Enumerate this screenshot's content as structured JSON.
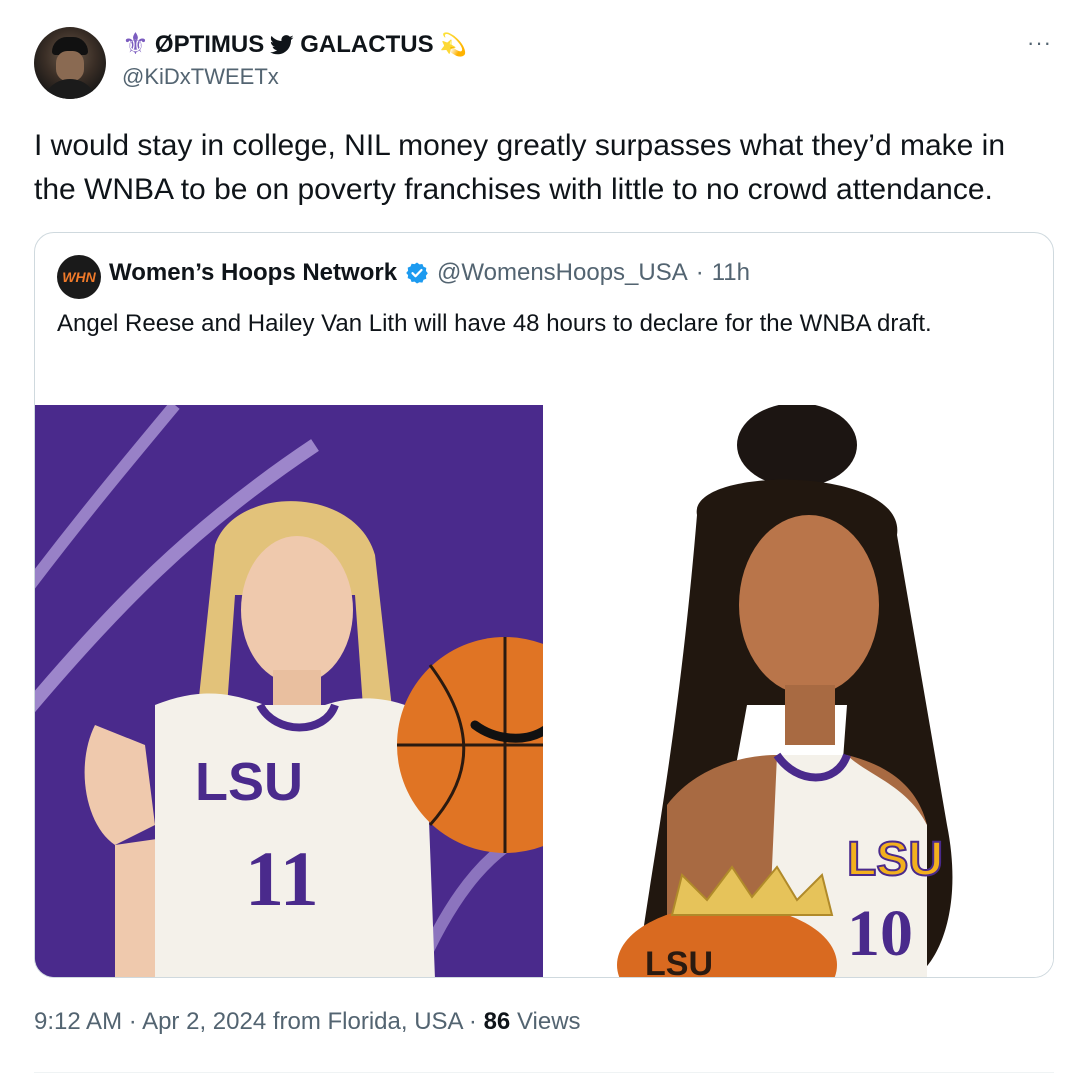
{
  "author": {
    "display_name": "ØPTIMUS",
    "display_name_2": "GALACTUS",
    "handle": "@KiDxTWEETx",
    "fleur_glyph": "⚜",
    "emoji_glyph": "💫"
  },
  "tweet": {
    "text": "I would stay in college, NIL money greatly surpasses what they’d make in the WNBA to be on poverty franchises with little to no crowd attendance."
  },
  "quoted": {
    "avatar_text": "WHN",
    "name": "Women’s Hoops Network",
    "handle": "@WomensHoops_USA",
    "separator": "·",
    "age": "11h",
    "text": "Angel Reese and Hailey Van Lith will have 48 hours to declare for the WNBA draft.",
    "media": {
      "left_jersey": "LSU",
      "left_number": "11",
      "right_jersey": "LSU",
      "right_number": "10",
      "ball_text": "LSU"
    }
  },
  "footer": {
    "time": "9:12 AM",
    "sep1": "·",
    "date": "Apr 2, 2024",
    "source": "from Florida, USA",
    "sep2": "·",
    "views_count": "86",
    "views_label": "Views"
  },
  "menu": {
    "more_glyph": "···"
  },
  "colors": {
    "text": "#0f1419",
    "secondary": "#536471",
    "verified": "#1d9bf0",
    "border": "#cfd9de",
    "lsu_purple": "#4a2a8c",
    "lsu_gold": "#f2b01e"
  }
}
